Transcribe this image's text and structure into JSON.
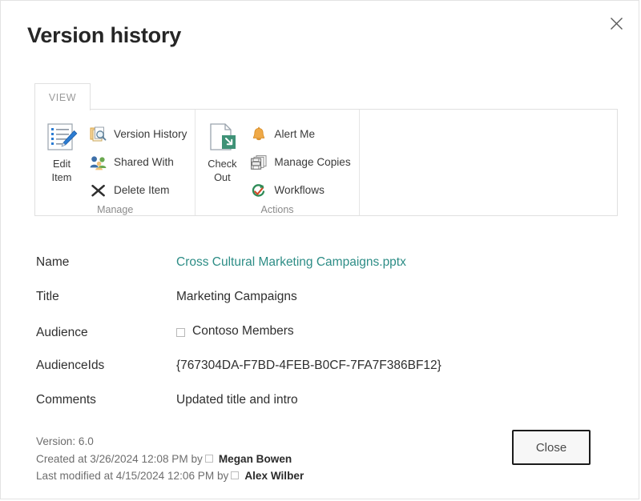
{
  "dialog": {
    "title": "Version history",
    "close_icon": "close-icon"
  },
  "ribbon": {
    "tabs": [
      {
        "label": "VIEW",
        "active": true
      }
    ],
    "groups": [
      {
        "name": "Manage",
        "label": "Manage",
        "big_buttons": [
          {
            "label_line1": "Edit",
            "label_line2": "Item",
            "icon": "edit-item-icon"
          }
        ],
        "small_buttons": [
          {
            "label": "Version History",
            "icon": "version-history-icon"
          },
          {
            "label": "Shared With",
            "icon": "shared-with-icon"
          },
          {
            "label": "Delete Item",
            "icon": "delete-item-icon"
          }
        ]
      },
      {
        "name": "Actions",
        "label": "Actions",
        "big_buttons": [
          {
            "label_line1": "Check",
            "label_line2": "Out",
            "icon": "check-out-icon"
          }
        ],
        "small_buttons": [
          {
            "label": "Alert Me",
            "icon": "alert-me-icon"
          },
          {
            "label": "Manage Copies",
            "icon": "manage-copies-icon"
          },
          {
            "label": "Workflows",
            "icon": "workflows-icon"
          }
        ]
      }
    ]
  },
  "fields": [
    {
      "label": "Name",
      "value": "Cross Cultural Marketing Campaigns.pptx",
      "is_link": true
    },
    {
      "label": "Title",
      "value": "Marketing Campaigns",
      "is_link": false
    },
    {
      "label": "Audience",
      "value": "Contoso Members",
      "is_link": false,
      "has_checkbox": true
    },
    {
      "label": "AudienceIds",
      "value": "{767304DA-F7BD-4FEB-B0CF-7FA7F386BF12}",
      "is_link": false
    },
    {
      "label": "Comments",
      "value": "Updated title and intro",
      "is_link": false
    }
  ],
  "footer": {
    "version_line": "Version: 6.0",
    "created_prefix": "Created at 3/26/2024 12:08 PM  by",
    "created_by": "Megan Bowen",
    "modified_prefix": "Last modified at 4/15/2024 12:06 PM  by",
    "modified_by": "Alex Wilber",
    "close_label": "Close"
  },
  "colors": {
    "link_teal": "#2d8d86",
    "pencil_blue": "#2b7cd3",
    "checkout_green": "#3f9277",
    "bell_orange": "#efa947",
    "workflow_green": "#2e8b57",
    "workflow_red": "#d24726",
    "border_gray": "#e0e0e0",
    "text_dark": "#2f2f2f",
    "text_muted": "#6e6e6e"
  }
}
